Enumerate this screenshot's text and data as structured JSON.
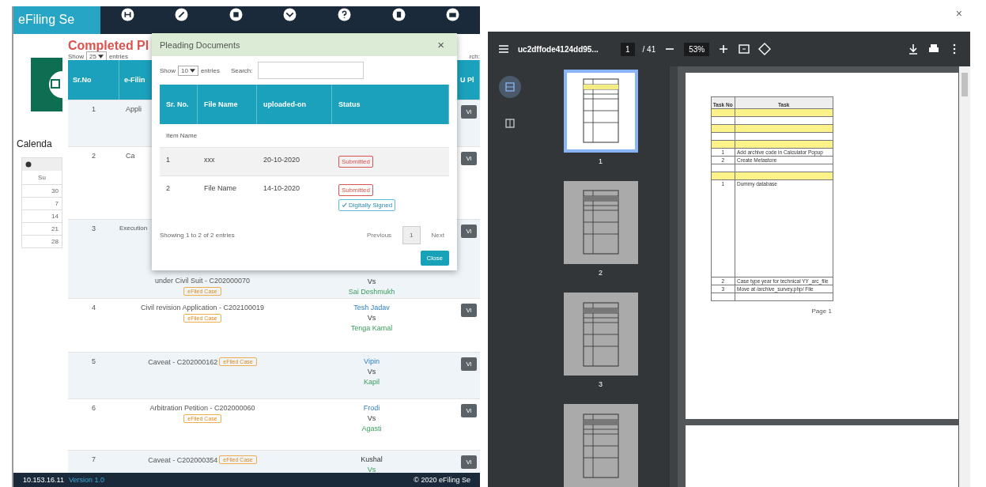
{
  "browser": {
    "close": "×"
  },
  "app": {
    "brand": "eFiling Se",
    "footer": {
      "ip": "10.153.16.11",
      "version": "Version 1.0",
      "copyright": "© 2020 eFiling Se"
    }
  },
  "sidebar": {
    "calendar_title": "Calenda",
    "calendar_day": "Su",
    "calendar_dates": [
      "30",
      "7",
      "14",
      "21",
      "28"
    ]
  },
  "main": {
    "title": "Completed Pl",
    "length": {
      "before": "Show",
      "value": "25",
      "after": "entries"
    },
    "search_fragment": "rch:",
    "columns": [
      "Sr.No",
      "e-Filin",
      "U Pl"
    ],
    "rows": [
      {
        "sr": "1",
        "filing": [
          "Appli"
        ],
        "parties": [],
        "action": "Vi"
      },
      {
        "sr": "2",
        "filing": [
          "Ca"
        ],
        "parties": [],
        "action": "Vi"
      },
      {
        "sr": "3",
        "filing": [
          "Execution",
          "under Civil Suit - C202000070"
        ],
        "badge": "eFiled Case",
        "parties": [
          "Vs",
          "Sai Deshmukh"
        ],
        "action": "Vi"
      },
      {
        "sr": "4",
        "filing": [
          "Civil revision Application - C202100019"
        ],
        "badge": "eFiled Case",
        "parties": [
          "Tesh Jadav",
          "Vs",
          "Tenga Kamal"
        ],
        "action": "Vi"
      },
      {
        "sr": "5",
        "filing": [
          "Caveat - C202000162"
        ],
        "badge": "eFiled Case",
        "inline_badge": true,
        "parties": [
          "Vipin",
          "Vs",
          "Kapil"
        ],
        "action": "Vi"
      },
      {
        "sr": "6",
        "filing": [
          "Arbitration Petition - C202000060"
        ],
        "badge": "eFiled Case",
        "parties": [
          "Frodi",
          "Vs",
          "Agasti"
        ],
        "action": "Vi"
      },
      {
        "sr": "7",
        "filing": [
          "Caveat - C202000354"
        ],
        "badge": "eFiled Case",
        "inline_badge": true,
        "parties": [
          "Kushal",
          "Vs"
        ],
        "action": "Vi"
      }
    ]
  },
  "modal": {
    "title": "Pleading Documents",
    "close": "×",
    "length": {
      "before": "Show",
      "value": "10",
      "after": "entries"
    },
    "search_label": "Search:",
    "columns": [
      "Sr. No.",
      "File Name",
      "uploaded-on",
      "Status"
    ],
    "group": "Item Name",
    "rows": [
      {
        "sr": "1",
        "file": "xxx",
        "date": "20-10-2020",
        "statuses": [
          {
            "text": "Submitted",
            "kind": "submitted"
          }
        ]
      },
      {
        "sr": "2",
        "file": "File Name",
        "date": "14-10-2020",
        "statuses": [
          {
            "text": "Submitted",
            "kind": "submitted"
          },
          {
            "text": "Digitally Signed",
            "kind": "signed"
          }
        ]
      }
    ],
    "info": "Showing 1 to 2 of 2 entries",
    "previous": "Previous",
    "pages": [
      {
        "label": "1",
        "selected": true
      }
    ],
    "next": "Next",
    "close_button": "Close"
  },
  "pdf": {
    "file": "uc2dffode4124dd95...",
    "page": "1",
    "total": "/ 41",
    "zoom": "53%",
    "sidebar_tabs": [
      {
        "kind": "thumbnails",
        "selected": true
      },
      {
        "kind": "outline",
        "selected": false
      }
    ],
    "thumbnails": [
      {
        "label": "1",
        "selected": true
      },
      {
        "label": "2",
        "selected": false
      },
      {
        "label": "3",
        "selected": false
      },
      {
        "selected": false
      }
    ],
    "table": {
      "columns": [
        "Task No",
        "Task"
      ],
      "rows": [
        {
          "kind": "highlight"
        },
        {
          "kind": "blank"
        },
        {
          "kind": "highlight"
        },
        {
          "kind": "blank"
        },
        {
          "kind": "highlight"
        },
        {
          "kind": "task",
          "no": "1",
          "task": "Add archive code in Calculator Popup"
        },
        {
          "kind": "task",
          "no": "2",
          "task": "Create Metastore"
        },
        {
          "kind": "blank"
        },
        {
          "kind": "highlight"
        },
        {
          "kind": "tall",
          "no": "1",
          "task": "Dummy database"
        },
        {
          "kind": "task",
          "no": "2",
          "task": "Case type year for technical YY_arc_file"
        },
        {
          "kind": "task",
          "no": "3",
          "task": "Move at /archive_survey.php/ File"
        },
        {
          "kind": "blank"
        }
      ]
    },
    "footer": "Page 1"
  }
}
